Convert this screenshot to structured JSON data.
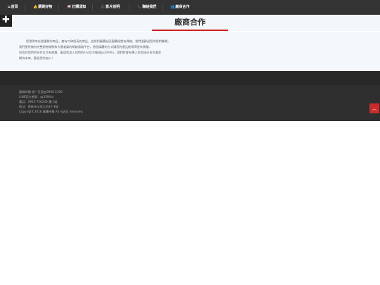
{
  "nav": {
    "items": [
      {
        "icon": "⌂",
        "label": "首頁"
      },
      {
        "icon": "👍",
        "label": "購買好物"
      },
      {
        "icon": "📢",
        "label": "訂購須知"
      },
      {
        "icon": "🎥",
        "label": "影片說明"
      },
      {
        "icon": "📞",
        "label": "聯絡我們"
      },
      {
        "icon": "👥",
        "label": "廠商合作"
      }
    ]
  },
  "page": {
    "title": "廠商合作"
  },
  "content": {
    "lines": [
      "您覺得本店是優質的商品，擁有口碑很高的商品，並想到團購社區團購經營有興趣，我們很歡迎您與我們聯繫。",
      "我們提供擁有完整銷售機制和大量會員的網路通路平台，透過媒體的方式讓您的產品能帶得很有銷量。",
      "如您對我們的合作方式有興趣，歡迎您加入我們的line官方帳號@339hla，我們將會有專人與您接洽合作事宜",
      "期待未來，歡迎您的加入！"
    ]
  },
  "footer": {
    "lines": [
      "服務時間 週一至週五0900-2100",
      "LINE官方帳號：@339hla",
      "電話：0952-756246 蕭小姐",
      "地址：雲林市斗南九份37-3號",
      "Copyright 2016 團購市集 All rights reserved."
    ]
  },
  "colors": {
    "nav_bg": "#333333",
    "accent": "#cc2222",
    "footer_bg": "#2f2f2f"
  }
}
